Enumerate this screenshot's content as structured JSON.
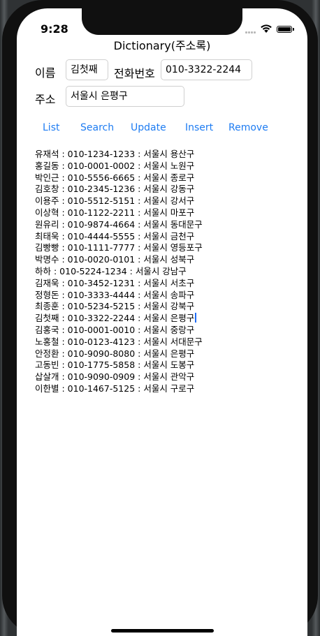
{
  "status_bar": {
    "time": "9:28"
  },
  "app": {
    "title": "Dictionary(주소록)"
  },
  "form": {
    "name_label": "이름",
    "name_value": "김첫째",
    "phone_label": "전화번호",
    "phone_value": "010-3322-2244",
    "address_label": "주소",
    "address_value": "서울시 은평구"
  },
  "buttons": {
    "list": "List",
    "search": "Search",
    "update": "Update",
    "insert": "Insert",
    "remove": "Remove"
  },
  "entries": [
    "유재석 : 010-1234-1233 : 서울시 용산구",
    "홍길동 : 010-0001-0002 : 서울시 노원구",
    "박인근 : 010-5556-6665 : 서울시 종로구",
    "김호창 : 010-2345-1236 : 서울시 강동구",
    "이용주 : 010-5512-5151 : 서울시 강서구",
    "이상혁 : 010-1122-2211 : 서울시 마포구",
    "원유리 : 010-9874-4664 : 서울시 동대문구",
    "최태욱 : 010-4444-5555 : 서울시 금천구",
    "김빵빵 : 010-1111-7777 : 서울시 영등포구",
    "박명수 : 010-0020-0101 : 서울시 성북구",
    "하하 : 010-5224-1234 : 서울시 강남구",
    "김재욱 : 010-3452-1231 : 서울시 서초구",
    "정형돈 : 010-3333-4444 : 서울시 송파구",
    "최종훈 : 010-5234-5215 : 서울시 강북구",
    "김첫째 : 010-3322-2244 : 서울시 은평구",
    "김홍국 : 010-0001-0010 : 서울시 중랑구",
    "노홍철 : 010-0123-4123 : 서울시 서대문구",
    "안정환 : 010-9090-8080 : 서울시 은평구",
    "고동빈 : 010-1775-5858 : 서울시 도봉구",
    "삽살개 : 010-9090-0909 : 서울시 관악구",
    "이한별 : 010-1467-5125 : 서울시 구로구"
  ],
  "colors": {
    "accent": "#1e7cf2",
    "text": "#000000",
    "field_border": "#d0d0d0"
  }
}
